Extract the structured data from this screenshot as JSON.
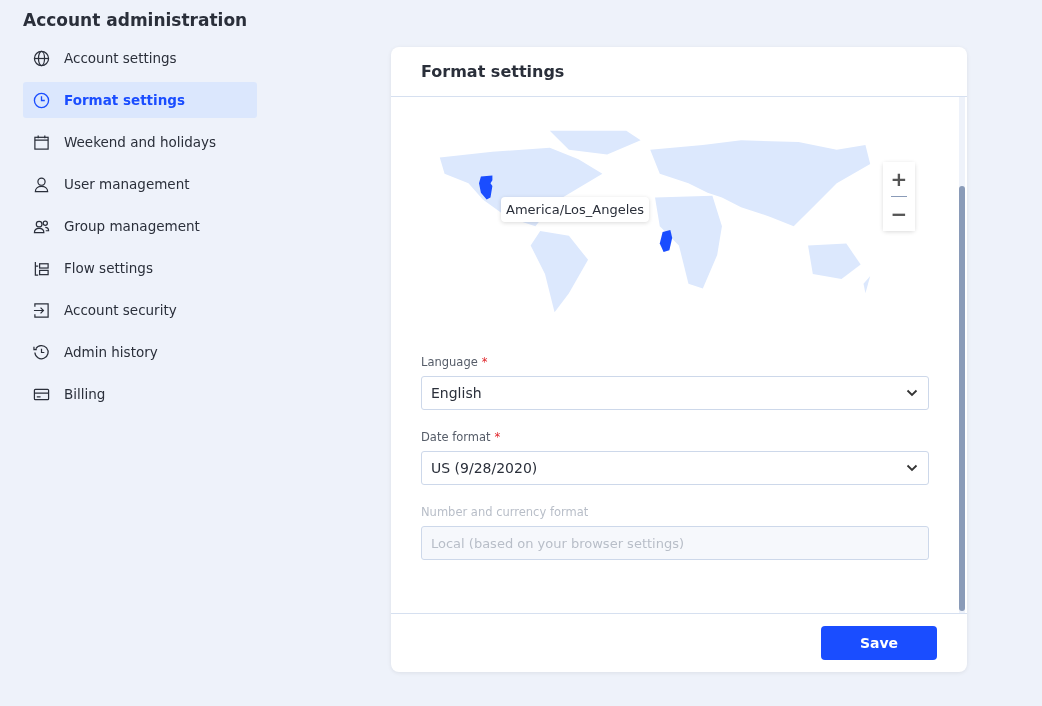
{
  "sidebar": {
    "title": "Account administration",
    "items": [
      {
        "label": "Account settings",
        "selected": false
      },
      {
        "label": "Format settings",
        "selected": true
      },
      {
        "label": "Weekend and holidays",
        "selected": false
      },
      {
        "label": "User management",
        "selected": false
      },
      {
        "label": "Group management",
        "selected": false
      },
      {
        "label": "Flow settings",
        "selected": false
      },
      {
        "label": "Account security",
        "selected": false
      },
      {
        "label": "Admin history",
        "selected": false
      },
      {
        "label": "Billing",
        "selected": false
      }
    ]
  },
  "panel": {
    "title": "Format settings",
    "map": {
      "tooltip": "America/Los_Angeles",
      "zoom_in": "+",
      "zoom_out": "−"
    },
    "fields": [
      {
        "kind": "select",
        "label": "Language",
        "required_mark": "*",
        "value": "English",
        "disabled": false
      },
      {
        "kind": "select",
        "label": "Date format",
        "required_mark": "*",
        "value": "US (9/28/2020)",
        "disabled": false
      },
      {
        "kind": "input",
        "label": "Number and currency format",
        "placeholder": "Local (based on your browser settings)",
        "disabled": true
      }
    ],
    "save_button": "Save"
  }
}
